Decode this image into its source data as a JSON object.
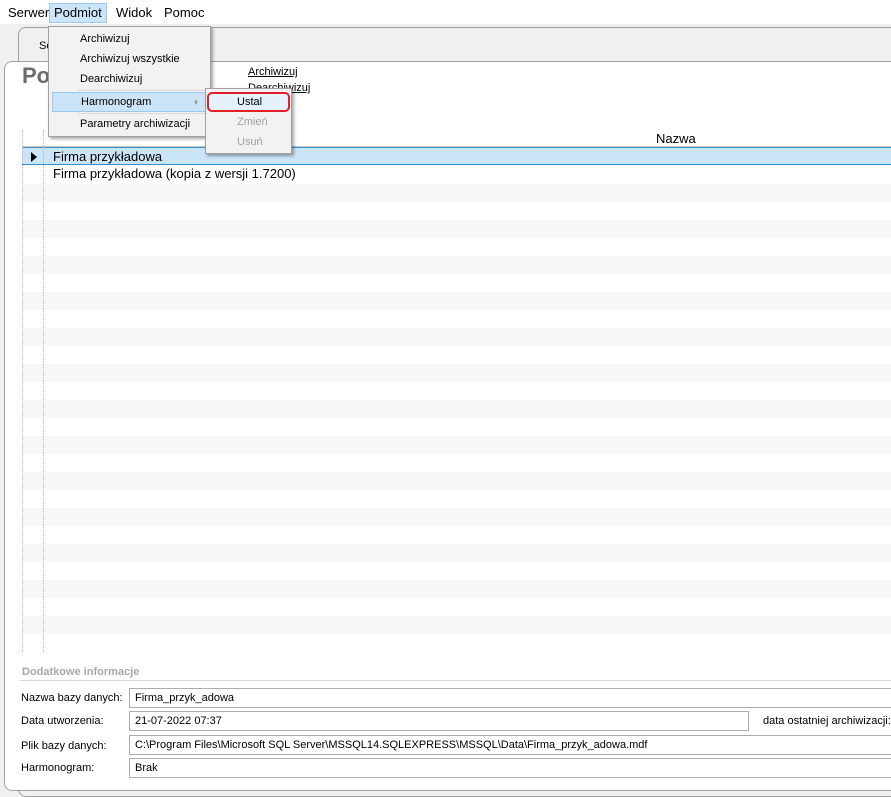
{
  "menubar": {
    "items": [
      "Serwer",
      "Podmiot",
      "Widok",
      "Pomoc"
    ],
    "active": "Podmiot"
  },
  "tab": {
    "label": "Se"
  },
  "page": {
    "title": "Po"
  },
  "actions": {
    "archive": "Archiwizuj",
    "dearchive": "Dearchiwizuj"
  },
  "dropdown": {
    "items": [
      "Archiwizuj",
      "Archiwizuj wszystkie",
      "Dearchiwizuj",
      "Harmonogram",
      "Parametry archiwizacji"
    ],
    "submenu": [
      "Ustal",
      "Zmień",
      "Usuń"
    ]
  },
  "grid": {
    "header": "Nazwa",
    "rows": [
      "Firma przykładowa",
      "Firma przykładowa (kopia z wersji 1.7200)"
    ],
    "selected_index": 0
  },
  "info": {
    "title": "Dodatkowe informacje",
    "db_name_label": "Nazwa bazy danych:",
    "db_name": "Firma_przyk_adowa",
    "created_label": "Data utworzenia:",
    "created": "21-07-2022 07:37",
    "last_archive_label": "data ostatniej archiwizacji:",
    "file_label": "Plik bazy danych:",
    "file": "C:\\Program Files\\Microsoft SQL Server\\MSSQL14.SQLEXPRESS\\MSSQL\\Data\\Firma_przyk_adowa.mdf",
    "schedule_label": "Harmonogram:",
    "schedule": "Brak"
  },
  "colors": {
    "selection": "#cce4f7",
    "selection_border": "#2f8fd7",
    "highlight_outline": "#e41e26"
  }
}
